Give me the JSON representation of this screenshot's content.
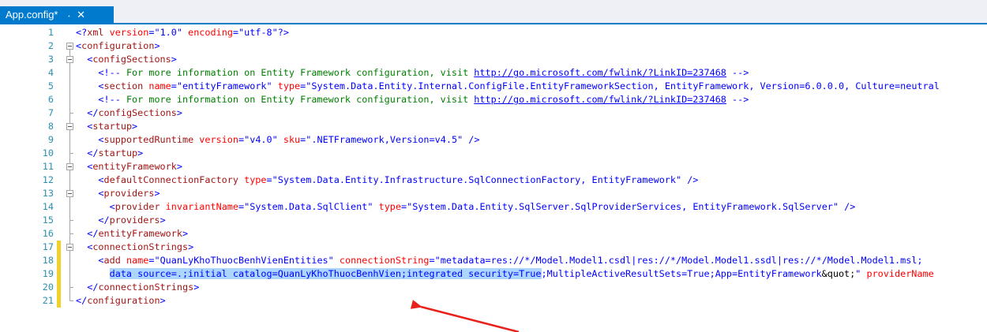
{
  "tab": {
    "title": "App.config*",
    "pin_icon": "pin-icon",
    "close_icon": "close-icon"
  },
  "lines": [
    {
      "n": "1",
      "parts": [
        [
          "d",
          "<?"
        ],
        [
          "t",
          "xml"
        ],
        [
          "a",
          " version"
        ],
        [
          "d",
          "=\""
        ],
        [
          "v",
          "1.0"
        ],
        [
          "d",
          "\""
        ],
        [
          "a",
          " encoding"
        ],
        [
          "d",
          "=\""
        ],
        [
          "v",
          "utf-8"
        ],
        [
          "d",
          "\"?>"
        ]
      ]
    },
    {
      "n": "2",
      "parts": [
        [
          "d",
          "<"
        ],
        [
          "t",
          "configuration"
        ],
        [
          "d",
          ">"
        ]
      ]
    },
    {
      "n": "3",
      "parts": [
        [
          "k",
          "  "
        ],
        [
          "d",
          "<"
        ],
        [
          "t",
          "configSections"
        ],
        [
          "d",
          ">"
        ]
      ]
    },
    {
      "n": "4",
      "parts": [
        [
          "k",
          "    "
        ],
        [
          "d",
          "<!--"
        ],
        [
          "c",
          " For more information on Entity Framework configuration, visit "
        ],
        [
          "u",
          "http://go.microsoft.com/fwlink/?LinkID=237468"
        ],
        [
          "c",
          " "
        ],
        [
          "d",
          "-->"
        ]
      ]
    },
    {
      "n": "5",
      "parts": [
        [
          "k",
          "    "
        ],
        [
          "d",
          "<"
        ],
        [
          "t",
          "section"
        ],
        [
          "a",
          " name"
        ],
        [
          "d",
          "=\""
        ],
        [
          "v",
          "entityFramework"
        ],
        [
          "d",
          "\""
        ],
        [
          "a",
          " type"
        ],
        [
          "d",
          "=\""
        ],
        [
          "v",
          "System.Data.Entity.Internal.ConfigFile.EntityFrameworkSection, EntityFramework, Version=6.0.0.0, Culture=neutral"
        ]
      ]
    },
    {
      "n": "6",
      "parts": [
        [
          "k",
          "    "
        ],
        [
          "d",
          "<!--"
        ],
        [
          "c",
          " For more information on Entity Framework configuration, visit "
        ],
        [
          "u",
          "http://go.microsoft.com/fwlink/?LinkID=237468"
        ],
        [
          "c",
          " "
        ],
        [
          "d",
          "-->"
        ]
      ]
    },
    {
      "n": "7",
      "parts": [
        [
          "k",
          "  "
        ],
        [
          "d",
          "</"
        ],
        [
          "t",
          "configSections"
        ],
        [
          "d",
          ">"
        ]
      ]
    },
    {
      "n": "8",
      "parts": [
        [
          "k",
          "  "
        ],
        [
          "d",
          "<"
        ],
        [
          "t",
          "startup"
        ],
        [
          "d",
          ">"
        ]
      ]
    },
    {
      "n": "9",
      "parts": [
        [
          "k",
          "    "
        ],
        [
          "d",
          "<"
        ],
        [
          "t",
          "supportedRuntime"
        ],
        [
          "a",
          " version"
        ],
        [
          "d",
          "=\""
        ],
        [
          "v",
          "v4.0"
        ],
        [
          "d",
          "\""
        ],
        [
          "a",
          " sku"
        ],
        [
          "d",
          "=\""
        ],
        [
          "v",
          ".NETFramework,Version=v4.5"
        ],
        [
          "d",
          "\" />"
        ]
      ]
    },
    {
      "n": "10",
      "parts": [
        [
          "k",
          "  "
        ],
        [
          "d",
          "</"
        ],
        [
          "t",
          "startup"
        ],
        [
          "d",
          ">"
        ]
      ]
    },
    {
      "n": "11",
      "parts": [
        [
          "k",
          "  "
        ],
        [
          "d",
          "<"
        ],
        [
          "t",
          "entityFramework"
        ],
        [
          "d",
          ">"
        ]
      ]
    },
    {
      "n": "12",
      "parts": [
        [
          "k",
          "    "
        ],
        [
          "d",
          "<"
        ],
        [
          "t",
          "defaultConnectionFactory"
        ],
        [
          "a",
          " type"
        ],
        [
          "d",
          "=\""
        ],
        [
          "v",
          "System.Data.Entity.Infrastructure.SqlConnectionFactory, EntityFramework"
        ],
        [
          "d",
          "\" />"
        ]
      ]
    },
    {
      "n": "13",
      "parts": [
        [
          "k",
          "    "
        ],
        [
          "d",
          "<"
        ],
        [
          "t",
          "providers"
        ],
        [
          "d",
          ">"
        ]
      ]
    },
    {
      "n": "14",
      "parts": [
        [
          "k",
          "      "
        ],
        [
          "d",
          "<"
        ],
        [
          "t",
          "provider"
        ],
        [
          "a",
          " invariantName"
        ],
        [
          "d",
          "=\""
        ],
        [
          "v",
          "System.Data.SqlClient"
        ],
        [
          "d",
          "\""
        ],
        [
          "a",
          " type"
        ],
        [
          "d",
          "=\""
        ],
        [
          "v",
          "System.Data.Entity.SqlServer.SqlProviderServices, EntityFramework.SqlServer"
        ],
        [
          "d",
          "\" />"
        ]
      ]
    },
    {
      "n": "15",
      "parts": [
        [
          "k",
          "    "
        ],
        [
          "d",
          "</"
        ],
        [
          "t",
          "providers"
        ],
        [
          "d",
          ">"
        ]
      ]
    },
    {
      "n": "16",
      "parts": [
        [
          "k",
          "  "
        ],
        [
          "d",
          "</"
        ],
        [
          "t",
          "entityFramework"
        ],
        [
          "d",
          ">"
        ]
      ]
    },
    {
      "n": "17",
      "parts": [
        [
          "k",
          "  "
        ],
        [
          "d",
          "<"
        ],
        [
          "t",
          "connectionStrings"
        ],
        [
          "d",
          ">"
        ]
      ]
    },
    {
      "n": "18",
      "parts": [
        [
          "k",
          "    "
        ],
        [
          "d",
          "<"
        ],
        [
          "t",
          "add"
        ],
        [
          "a",
          " name"
        ],
        [
          "d",
          "=\""
        ],
        [
          "v",
          "QuanLyKhoThuocBenhVienEntities"
        ],
        [
          "d",
          "\""
        ],
        [
          "a",
          " connectionString"
        ],
        [
          "d",
          "=\""
        ],
        [
          "v",
          "metadata=res://*/Model.Model1.csdl|res://*/Model.Model1.ssdl|res://*/Model.Model1.msl;"
        ]
      ]
    },
    {
      "n": "19",
      "parts": [
        [
          "k",
          "      "
        ],
        [
          "vs",
          "data source=.;initial catalog=QuanLyKhoThuocBenhVien;integrated security=True"
        ],
        [
          "v",
          ";MultipleActiveResultSets=True;App=EntityFramework"
        ],
        [
          "k",
          "&quot;"
        ],
        [
          "v",
          "\""
        ],
        [
          "a",
          " providerName"
        ]
      ]
    },
    {
      "n": "20",
      "parts": [
        [
          "k",
          "  "
        ],
        [
          "d",
          "</"
        ],
        [
          "t",
          "connectionStrings"
        ],
        [
          "d",
          ">"
        ]
      ]
    },
    {
      "n": "21",
      "parts": [
        [
          "d",
          "</"
        ],
        [
          "t",
          "configuration"
        ],
        [
          "d",
          ">"
        ]
      ]
    }
  ],
  "annotation": {
    "arrow_color": "#e8221b"
  }
}
